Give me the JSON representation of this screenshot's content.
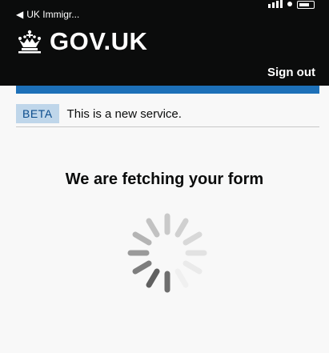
{
  "status_bar": {
    "back_label": "UK Immigr..."
  },
  "header": {
    "brand": "GOV.UK",
    "sign_out": "Sign out"
  },
  "phase_banner": {
    "tag": "BETA",
    "text": "This is a new service."
  },
  "main": {
    "heading": "We are fetching your form"
  },
  "icons": {
    "back": "back-arrow-icon",
    "crown": "crown-icon",
    "spinner": "loading-spinner-icon"
  },
  "colors": {
    "header_bg": "#0b0c0c",
    "brand_blue": "#1d70b8",
    "phase_tag_bg": "#bfd6ea",
    "page_bg": "#f8f8f8"
  }
}
